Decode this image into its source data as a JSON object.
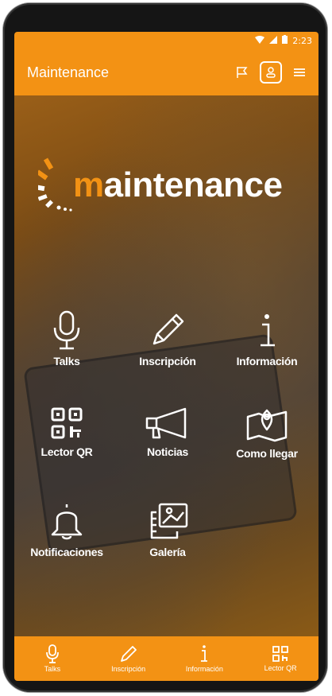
{
  "statusbar": {
    "time": "2:23"
  },
  "appbar": {
    "title": "Maintenance"
  },
  "logo": {
    "text_first": "m",
    "text_rest": "aintenance"
  },
  "tiles": [
    {
      "label": "Talks",
      "icon": "microphone-icon"
    },
    {
      "label": "Inscripción",
      "icon": "pencil-icon"
    },
    {
      "label": "Información",
      "icon": "info-icon"
    },
    {
      "label": "Lector QR",
      "icon": "qr-code-icon"
    },
    {
      "label": "Noticias",
      "icon": "megaphone-icon"
    },
    {
      "label": "Como llegar",
      "icon": "map-pin-icon"
    },
    {
      "label": "Notificaciones",
      "icon": "bell-icon"
    },
    {
      "label": "Galería",
      "icon": "gallery-icon"
    }
  ],
  "bottomnav": [
    {
      "label": "Talks",
      "icon": "microphone-icon"
    },
    {
      "label": "Inscripción",
      "icon": "pencil-icon"
    },
    {
      "label": "Información",
      "icon": "info-icon"
    },
    {
      "label": "Lector QR",
      "icon": "qr-code-icon"
    }
  ],
  "colors": {
    "accent": "#f39214",
    "text": "#ffffff"
  }
}
